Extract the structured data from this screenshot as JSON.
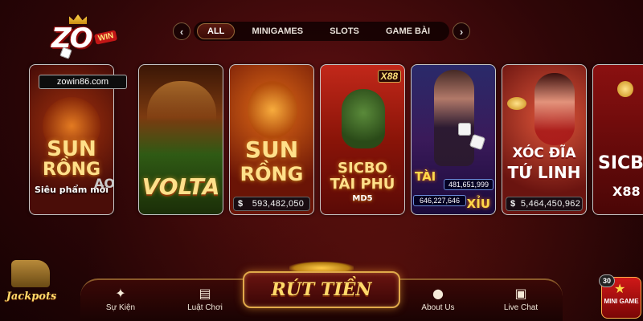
{
  "logo": {
    "brand": "ZO",
    "badge": "WIN"
  },
  "url_badge": "zowin86.com",
  "tabs": [
    {
      "label": "ALL",
      "active": true
    },
    {
      "label": "MINIGAMES",
      "active": false
    },
    {
      "label": "SLOTS",
      "active": false
    },
    {
      "label": "GAME BÀI",
      "active": false
    }
  ],
  "games": {
    "sun_rong_left": {
      "line1": "SUN",
      "line2": "RỒNG",
      "sub": "Siêu phẩm mới",
      "badge_partial": "AO"
    },
    "volta": {
      "title": "VOLTA"
    },
    "sun_rong": {
      "line1": "SUN",
      "line2": "RỒNG",
      "jackpot": "593,482,050"
    },
    "sicbo": {
      "line1": "SICBO",
      "line2": "TÀI PHÚ",
      "line3": "MD5",
      "badge": "X88"
    },
    "taixiu": {
      "tai": "TÀI",
      "tai_amount": "481,651,999",
      "xiu": "XỈU",
      "xiu_amount": "646,227,646"
    },
    "xocdia": {
      "line1": "XÓC ĐĨA",
      "line2": "TỨ LINH",
      "jackpot": "5,464,450,962"
    },
    "sicbo88": {
      "line1": "SICB",
      "line2": "X88"
    }
  },
  "currency_symbol": "$",
  "bottom_nav": {
    "events": "Sự Kiện",
    "rules": "Luật Chơi",
    "withdraw": "RÚT TIỀN",
    "about": "About Us",
    "livechat": "Live Chat"
  },
  "jackpots_label": "Jackpots",
  "minigame": {
    "label": "MINI GAME",
    "count": "30"
  },
  "icons": {
    "events": "party-popper-icon",
    "rules": "book-icon",
    "about": "user-icon",
    "livechat": "chat-icon",
    "prev": "chevron-left-icon",
    "next": "chevron-right-icon"
  },
  "colors": {
    "gold": "#ffd96a",
    "bg": "#2e0607",
    "accent": "#c31616"
  }
}
